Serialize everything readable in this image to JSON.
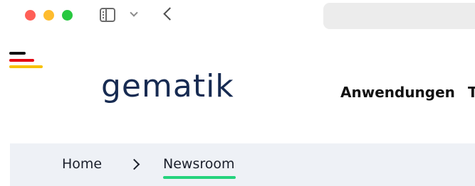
{
  "browser": {
    "traffic_lights": [
      {
        "name": "close",
        "color": "#ff5f57"
      },
      {
        "name": "minimize",
        "color": "#febc2e"
      },
      {
        "name": "zoom",
        "color": "#28c840"
      }
    ],
    "icons": [
      "sidebar-toggle-icon",
      "chevron-down-icon",
      "back-arrow-icon"
    ],
    "address_bar": {
      "value": ""
    }
  },
  "header": {
    "menu_icon": "hamburger-icon",
    "menu_colors": [
      "#111111",
      "#e30613",
      "#f7c100"
    ],
    "brand_name": "gematik",
    "brand_color": "#172b52",
    "nav_items": [
      {
        "label": "Anwendungen"
      },
      {
        "label": "T"
      }
    ]
  },
  "breadcrumb": {
    "items": [
      {
        "label": "Home"
      },
      {
        "label": "Newsroom",
        "active": true
      }
    ],
    "separator_icon": "chevron-right-icon",
    "active_color": "#24d37d"
  }
}
